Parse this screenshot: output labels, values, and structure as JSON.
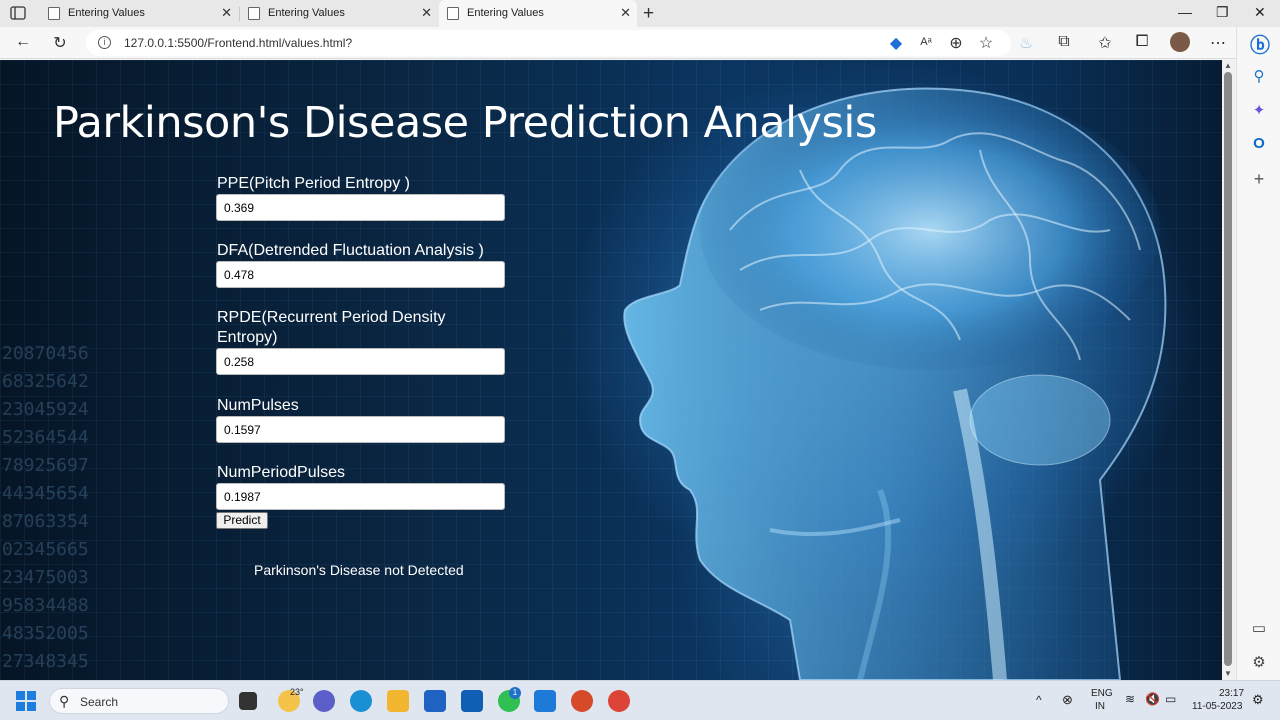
{
  "browser": {
    "tabs": [
      {
        "title": "Entering Values",
        "active": false
      },
      {
        "title": "Entering Values",
        "active": false
      },
      {
        "title": "Entering Values",
        "active": true
      }
    ],
    "url": "127.0.0.1:5500/Frontend.html/values.html?"
  },
  "page": {
    "title": "Parkinson's Disease Prediction Analysis",
    "fields": [
      {
        "label": "PPE(Pitch Period Entropy )",
        "value": "0.369"
      },
      {
        "label": "DFA(Detrended Fluctuation Analysis )",
        "value": "0.478"
      },
      {
        "label": "RPDE(Recurrent Period Density Entropy)",
        "value": "0.258"
      },
      {
        "label": "NumPulses",
        "value": "0.1597"
      },
      {
        "label": "NumPeriodPulses",
        "value": "0.1987"
      }
    ],
    "predict_label": "Predict",
    "result": "Parkinson's Disease not Detected"
  },
  "taskbar": {
    "search_label": "Search",
    "weather": "23°",
    "whatsapp_badge": "1",
    "lang_top": "ENG",
    "lang_bottom": "IN",
    "time": "23:17",
    "date": "11-05-2023"
  },
  "colors": {
    "page_bg": "#0a2744",
    "accent": "#1e72c8"
  }
}
